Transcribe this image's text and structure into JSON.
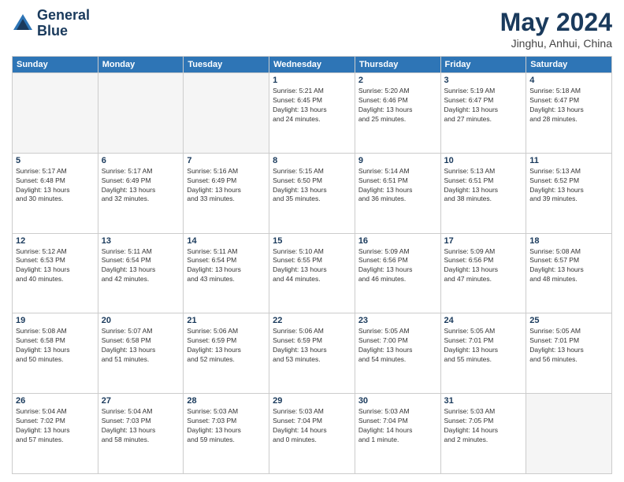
{
  "header": {
    "logo_line1": "General",
    "logo_line2": "Blue",
    "title": "May 2024",
    "subtitle": "Jinghu, Anhui, China"
  },
  "days_of_week": [
    "Sunday",
    "Monday",
    "Tuesday",
    "Wednesday",
    "Thursday",
    "Friday",
    "Saturday"
  ],
  "weeks": [
    [
      {
        "day": "",
        "info": ""
      },
      {
        "day": "",
        "info": ""
      },
      {
        "day": "",
        "info": ""
      },
      {
        "day": "1",
        "info": "Sunrise: 5:21 AM\nSunset: 6:45 PM\nDaylight: 13 hours\nand 24 minutes."
      },
      {
        "day": "2",
        "info": "Sunrise: 5:20 AM\nSunset: 6:46 PM\nDaylight: 13 hours\nand 25 minutes."
      },
      {
        "day": "3",
        "info": "Sunrise: 5:19 AM\nSunset: 6:47 PM\nDaylight: 13 hours\nand 27 minutes."
      },
      {
        "day": "4",
        "info": "Sunrise: 5:18 AM\nSunset: 6:47 PM\nDaylight: 13 hours\nand 28 minutes."
      }
    ],
    [
      {
        "day": "5",
        "info": "Sunrise: 5:17 AM\nSunset: 6:48 PM\nDaylight: 13 hours\nand 30 minutes."
      },
      {
        "day": "6",
        "info": "Sunrise: 5:17 AM\nSunset: 6:49 PM\nDaylight: 13 hours\nand 32 minutes."
      },
      {
        "day": "7",
        "info": "Sunrise: 5:16 AM\nSunset: 6:49 PM\nDaylight: 13 hours\nand 33 minutes."
      },
      {
        "day": "8",
        "info": "Sunrise: 5:15 AM\nSunset: 6:50 PM\nDaylight: 13 hours\nand 35 minutes."
      },
      {
        "day": "9",
        "info": "Sunrise: 5:14 AM\nSunset: 6:51 PM\nDaylight: 13 hours\nand 36 minutes."
      },
      {
        "day": "10",
        "info": "Sunrise: 5:13 AM\nSunset: 6:51 PM\nDaylight: 13 hours\nand 38 minutes."
      },
      {
        "day": "11",
        "info": "Sunrise: 5:13 AM\nSunset: 6:52 PM\nDaylight: 13 hours\nand 39 minutes."
      }
    ],
    [
      {
        "day": "12",
        "info": "Sunrise: 5:12 AM\nSunset: 6:53 PM\nDaylight: 13 hours\nand 40 minutes."
      },
      {
        "day": "13",
        "info": "Sunrise: 5:11 AM\nSunset: 6:54 PM\nDaylight: 13 hours\nand 42 minutes."
      },
      {
        "day": "14",
        "info": "Sunrise: 5:11 AM\nSunset: 6:54 PM\nDaylight: 13 hours\nand 43 minutes."
      },
      {
        "day": "15",
        "info": "Sunrise: 5:10 AM\nSunset: 6:55 PM\nDaylight: 13 hours\nand 44 minutes."
      },
      {
        "day": "16",
        "info": "Sunrise: 5:09 AM\nSunset: 6:56 PM\nDaylight: 13 hours\nand 46 minutes."
      },
      {
        "day": "17",
        "info": "Sunrise: 5:09 AM\nSunset: 6:56 PM\nDaylight: 13 hours\nand 47 minutes."
      },
      {
        "day": "18",
        "info": "Sunrise: 5:08 AM\nSunset: 6:57 PM\nDaylight: 13 hours\nand 48 minutes."
      }
    ],
    [
      {
        "day": "19",
        "info": "Sunrise: 5:08 AM\nSunset: 6:58 PM\nDaylight: 13 hours\nand 50 minutes."
      },
      {
        "day": "20",
        "info": "Sunrise: 5:07 AM\nSunset: 6:58 PM\nDaylight: 13 hours\nand 51 minutes."
      },
      {
        "day": "21",
        "info": "Sunrise: 5:06 AM\nSunset: 6:59 PM\nDaylight: 13 hours\nand 52 minutes."
      },
      {
        "day": "22",
        "info": "Sunrise: 5:06 AM\nSunset: 6:59 PM\nDaylight: 13 hours\nand 53 minutes."
      },
      {
        "day": "23",
        "info": "Sunrise: 5:05 AM\nSunset: 7:00 PM\nDaylight: 13 hours\nand 54 minutes."
      },
      {
        "day": "24",
        "info": "Sunrise: 5:05 AM\nSunset: 7:01 PM\nDaylight: 13 hours\nand 55 minutes."
      },
      {
        "day": "25",
        "info": "Sunrise: 5:05 AM\nSunset: 7:01 PM\nDaylight: 13 hours\nand 56 minutes."
      }
    ],
    [
      {
        "day": "26",
        "info": "Sunrise: 5:04 AM\nSunset: 7:02 PM\nDaylight: 13 hours\nand 57 minutes."
      },
      {
        "day": "27",
        "info": "Sunrise: 5:04 AM\nSunset: 7:03 PM\nDaylight: 13 hours\nand 58 minutes."
      },
      {
        "day": "28",
        "info": "Sunrise: 5:03 AM\nSunset: 7:03 PM\nDaylight: 13 hours\nand 59 minutes."
      },
      {
        "day": "29",
        "info": "Sunrise: 5:03 AM\nSunset: 7:04 PM\nDaylight: 14 hours\nand 0 minutes."
      },
      {
        "day": "30",
        "info": "Sunrise: 5:03 AM\nSunset: 7:04 PM\nDaylight: 14 hours\nand 1 minute."
      },
      {
        "day": "31",
        "info": "Sunrise: 5:03 AM\nSunset: 7:05 PM\nDaylight: 14 hours\nand 2 minutes."
      },
      {
        "day": "",
        "info": ""
      }
    ]
  ]
}
